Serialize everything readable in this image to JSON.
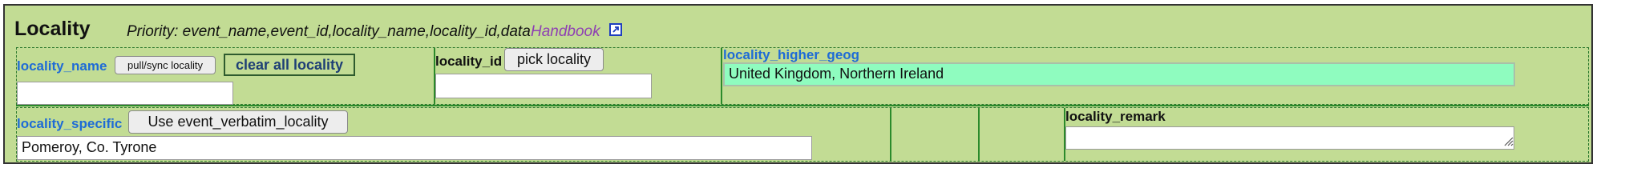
{
  "header": {
    "title": "Locality",
    "priority": "Priority: event_name,event_id,locality_name,locality_id,data",
    "handbook_link": "Handbook",
    "external_icon": "external-link-icon"
  },
  "row1": {
    "locality_name_label": "locality_name",
    "pull_sync_button": "pull/sync locality",
    "clear_all_button": "clear all locality",
    "locality_name_value": "",
    "locality_id_label": "locality_id",
    "pick_locality_button": "pick locality",
    "locality_id_value": "",
    "higher_geog_label": "locality_higher_geog",
    "higher_geog_value": "United Kingdom, Northern Ireland"
  },
  "row2": {
    "locality_specific_label": "locality_specific",
    "use_verbatim_button": "Use event_verbatim_locality",
    "locality_specific_value": "Pomeroy, Co. Tyrone",
    "locality_remark_label": "locality_remark",
    "locality_remark_value": ""
  },
  "colors": {
    "panel_background": "#c2dc94",
    "label_blue": "#1e6bd6",
    "link_purple": "#8e3fb3",
    "highlight_field": "#8ffcbf"
  }
}
